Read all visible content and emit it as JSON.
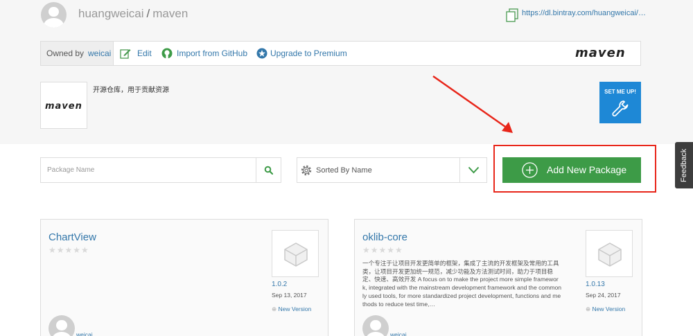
{
  "header": {
    "owner": "huangweicai",
    "separator": "/",
    "repo": "maven",
    "url": "https://dl.bintray.com/huangweicai/…"
  },
  "owner_bar": {
    "owned_by_label": "Owned by",
    "owner": "weicai",
    "edit_label": "Edit",
    "import_label": "Import from GitHub",
    "upgrade_label": "Upgrade to Premium",
    "logo_text": "maven"
  },
  "repo_info": {
    "logo_text": "maven",
    "description": "开源仓库，用于贡献资源",
    "set_me_up_label": "SET ME UP!"
  },
  "toolbar": {
    "search_placeholder": "Package Name",
    "sort_label": "Sorted By Name",
    "add_package_label": "Add New Package"
  },
  "feedback_label": "Feedback",
  "packages": [
    {
      "name": "ChartView",
      "stars": "★★★★★",
      "description": "",
      "version": "1.0.2",
      "date": "Sep 13, 2017",
      "new_version_label": "New Version",
      "owner": "weicai"
    },
    {
      "name": "oklib-core",
      "stars": "★★★★★",
      "description": "一个专注于让项目开发更简单的框架，集成了主流的开发框架及常用的工具类，让项目开发更加统一规范，减少功能及方法测试时间，助力于项目稳定、快速、高效开发 A focus on to make the project more simple framework, integrated with the mainstream development framework and the commonly used tools, for more standardized project development, functions and methods to reduce test time,…",
      "version": "1.0.13",
      "date": "Sep 24, 2017",
      "new_version_label": "New Version",
      "owner": "weicai"
    }
  ],
  "colors": {
    "link": "#3377aa",
    "add_button": "#3d9b47",
    "set_me_up": "#1e88d6",
    "annotation": "#e8261a"
  }
}
